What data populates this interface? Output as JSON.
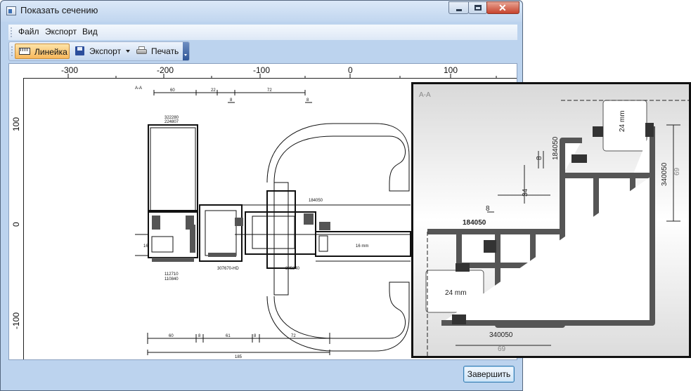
{
  "window": {
    "title": "Показать сечению"
  },
  "menu": {
    "items": [
      "Файл",
      "Экспорт",
      "Вид"
    ]
  },
  "toolbar": {
    "ruler_label": "Линейка",
    "export_label": "Экспорт",
    "print_label": "Печать"
  },
  "ruler": {
    "h_ticks": [
      "-300",
      "-200",
      "-100",
      "0",
      "100"
    ],
    "v_ticks": [
      "100",
      "0",
      "-100"
    ]
  },
  "drawing": {
    "section_label": "A-A",
    "top_codes": [
      "322280",
      "224807"
    ],
    "top_dims": [
      "60",
      "22",
      "72",
      "8",
      "8"
    ],
    "right_code": "184050",
    "glass_left": "16",
    "glass_right": "16 mm",
    "bottom_codes_left": [
      "112710",
      "110840"
    ],
    "bottom_code_mid": "307670-HD",
    "bottom_code_right": "305240",
    "bottom_dims": [
      "60",
      "8",
      "61",
      "8",
      "72"
    ],
    "bottom_total": "185"
  },
  "detail": {
    "section_label": "A-A",
    "glass_top": "24 mm",
    "glass_left": "24 mm",
    "code_top": "184050",
    "code_left": "184050",
    "code_right": "340050",
    "code_bottom": "340050",
    "dim_8a": "8",
    "dim_34": "34",
    "dim_8b": "8",
    "dim_69_right": "69",
    "dim_69_bottom": "69"
  },
  "footer": {
    "finish_label": "Завершить"
  },
  "colors": {
    "window_bg": "#bcd3ee",
    "button_active": "#f8b85c",
    "profile_gray": "#8a8a8a"
  }
}
